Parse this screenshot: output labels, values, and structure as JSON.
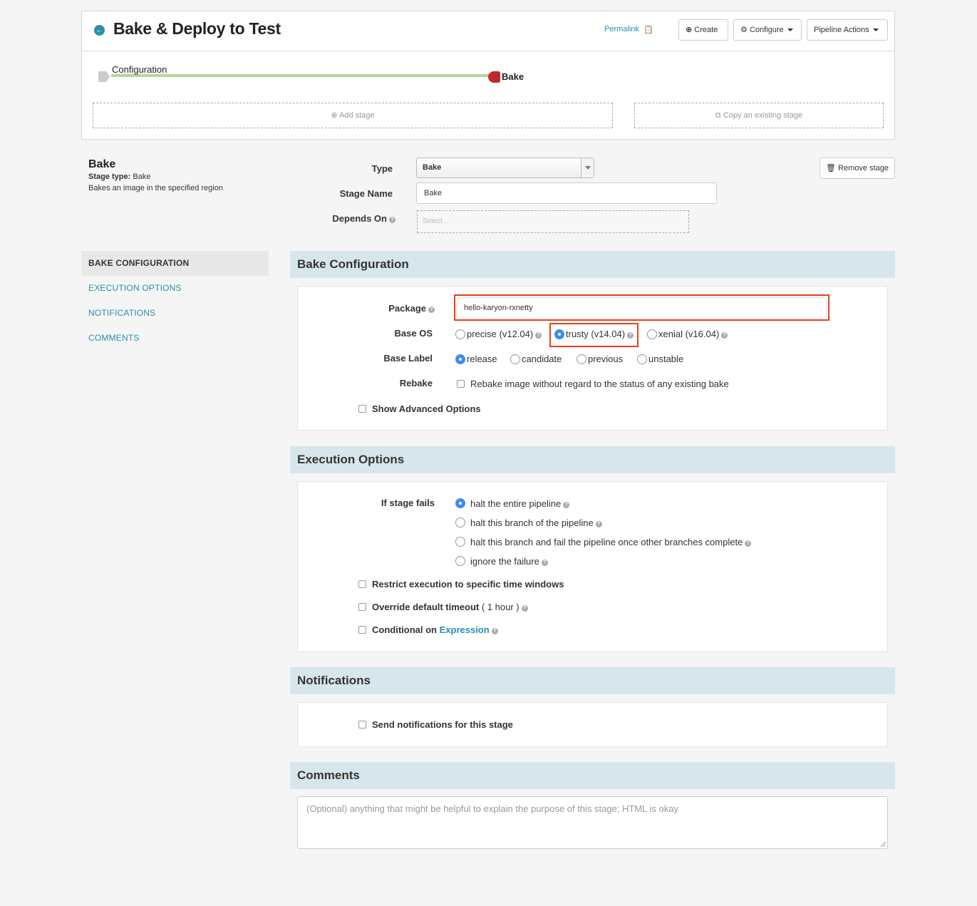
{
  "header": {
    "title": "Bake & Deploy to Test",
    "permalink": "Permalink",
    "create": "Create",
    "configure": "Configure",
    "pipeline_actions": "Pipeline Actions"
  },
  "graph": {
    "start_label": "Configuration",
    "end_label": "Bake",
    "add_stage": "Add stage",
    "copy_stage": "Copy an existing stage"
  },
  "stage": {
    "title": "Bake",
    "type_prefix": "Stage type:",
    "type_value": "Bake",
    "description": "Bakes an image in the specified region",
    "remove_label": "Remove stage"
  },
  "form": {
    "type_label": "Type",
    "type_value": "Bake",
    "name_label": "Stage Name",
    "name_value": "Bake",
    "depends_label": "Depends On",
    "depends_placeholder": "Select..."
  },
  "nav": [
    {
      "label": "BAKE CONFIGURATION"
    },
    {
      "label": "EXECUTION OPTIONS"
    },
    {
      "label": "NOTIFICATIONS"
    },
    {
      "label": "COMMENTS"
    }
  ],
  "bake": {
    "heading": "Bake Configuration",
    "package_label": "Package",
    "package_value": "hello-karyon-rxnetty",
    "base_os_label": "Base OS",
    "os_options": [
      "precise (v12.04)",
      "trusty (v14.04)",
      "xenial (v16.04)"
    ],
    "os_selected": "trusty (v14.04)",
    "base_label_label": "Base Label",
    "label_options": [
      "release",
      "candidate",
      "previous",
      "unstable"
    ],
    "label_selected": "release",
    "rebake_label": "Rebake",
    "rebake_text": "Rebake image without regard to the status of any existing bake",
    "advanced": "Show Advanced Options"
  },
  "execution": {
    "heading": "Execution Options",
    "fail_label": "If stage fails",
    "fail_options": [
      "halt the entire pipeline",
      "halt this branch of the pipeline",
      "halt this branch and fail the pipeline once other branches complete",
      "ignore the failure"
    ],
    "fail_selected": "halt the entire pipeline",
    "restrict": "Restrict execution to specific time windows",
    "override_bold": "Override default timeout",
    "override_rest": "( 1 hour )",
    "conditional_bold": "Conditional on",
    "conditional_link": "Expression"
  },
  "notifications": {
    "heading": "Notifications",
    "send": "Send notifications for this stage"
  },
  "comments": {
    "heading": "Comments",
    "placeholder": "(Optional) anything that might be helpful to explain the purpose of this stage; HTML is okay"
  },
  "colors": {
    "accent": "#2a8fa8",
    "section_header": "#d7e6ec",
    "highlight": "#e8401c",
    "radio_on": "#3b8ef0",
    "graph_line": "#b8d598",
    "bake_node": "#c0282a"
  }
}
